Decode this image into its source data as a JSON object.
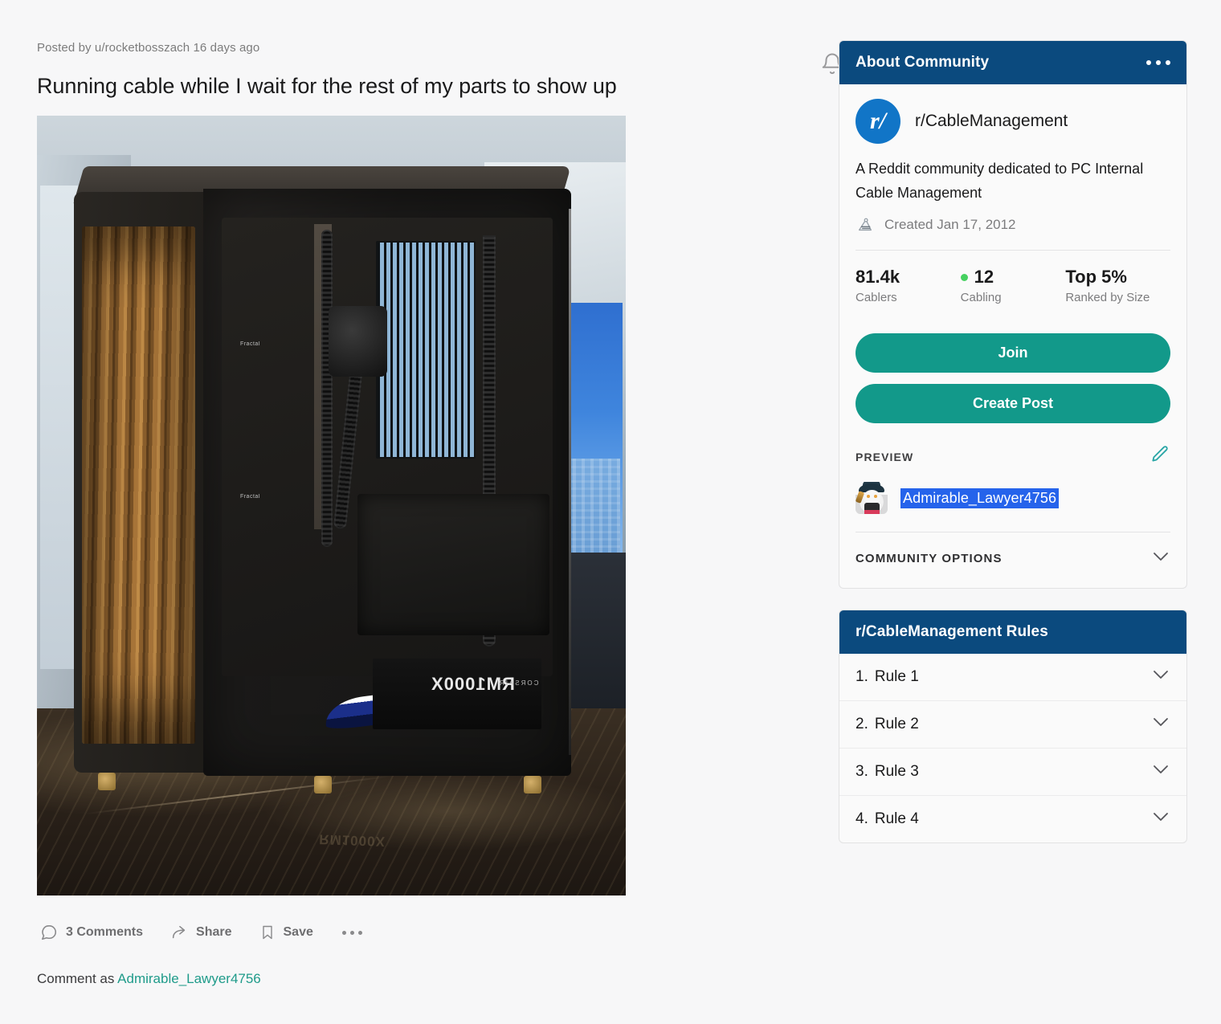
{
  "post": {
    "meta": "Posted by u/rocketbosszach 16 days ago",
    "title": "Running cable while I wait for the rest of my parts to show up",
    "notify_icon": "bell-icon",
    "image_alt": "Black PC case with wooden slatted front panel on a marble countertop",
    "image_text": {
      "psu_model": "RM1000X",
      "psu_brand": "CORSAIR",
      "reflection": "RM1000X",
      "case_brand_1": "Fractal",
      "case_brand_2": "Fractal"
    }
  },
  "actions": {
    "comments": "3 Comments",
    "share": "Share",
    "save": "Save",
    "more": "more-options"
  },
  "comment_as": {
    "prefix": "Comment as ",
    "username": "Admirable_Lawyer4756"
  },
  "about": {
    "header": "About Community",
    "avatar_text": "r/",
    "subreddit": "r/CableManagement",
    "description": "A Reddit community dedicated to PC Internal Cable Management",
    "created": "Created Jan 17, 2012",
    "stats": [
      {
        "value": "81.4k",
        "label": "Cablers",
        "online": false
      },
      {
        "value": "12",
        "label": "Cabling",
        "online": true
      },
      {
        "value": "Top 5%",
        "label": "Ranked by Size",
        "online": false
      }
    ],
    "join_label": "Join",
    "create_post_label": "Create Post",
    "preview_label": "PREVIEW",
    "preview_username": "Admirable_Lawyer4756",
    "community_options_label": "COMMUNITY OPTIONS"
  },
  "rules": {
    "header": "r/CableManagement Rules",
    "items": [
      {
        "num": "1.",
        "label": "Rule 1"
      },
      {
        "num": "2.",
        "label": "Rule 2"
      },
      {
        "num": "3.",
        "label": "Rule 3"
      },
      {
        "num": "4.",
        "label": "Rule 4"
      }
    ]
  },
  "colors": {
    "header_navy": "#0b4a7e",
    "accent_teal": "#12998a",
    "online_green": "#46d160",
    "selection_blue": "#2563eb",
    "avatar_blue": "#1175c7"
  }
}
